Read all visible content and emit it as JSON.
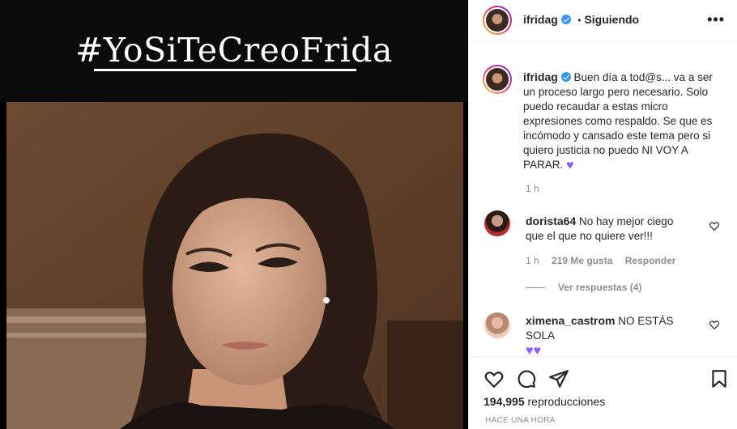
{
  "media": {
    "hashtag": "#YoSiTeCreoFrida"
  },
  "header": {
    "username": "ifridag",
    "separator": "•",
    "follow_status": "Siguiendo",
    "more_label": "•••"
  },
  "post": {
    "username": "ifridag",
    "caption_lines": [
      "Buen día a tod@s... va a ser",
      "un proceso largo pero necesario. Solo",
      "puedo recaudar a estas micro",
      "expresiones como respaldo. Se que es",
      "incómodo y cansado este tema pero si",
      "quiero justicia no puedo NI VOY A",
      "PARAR."
    ],
    "time": "1 h"
  },
  "comments": [
    {
      "username": "dorista64",
      "text_lines": [
        "No hay mejor ciego",
        "que el que no quiere ver!!!"
      ],
      "time": "1 h",
      "likes": "219 Me gusta",
      "reply": "Responder",
      "view_replies": "Ver respuestas (4)"
    },
    {
      "username": "ximena_castrom",
      "text": "NO ESTÁS SOLA",
      "emoji": "💜💜"
    }
  ],
  "footer": {
    "views_count": "194,995",
    "views_label": "reproducciones",
    "posted": "HACE UNA HORA"
  },
  "colors": {
    "verified": "#3897f0",
    "purple_heart": "#8e5cff",
    "muted": "#8e8e8e"
  }
}
